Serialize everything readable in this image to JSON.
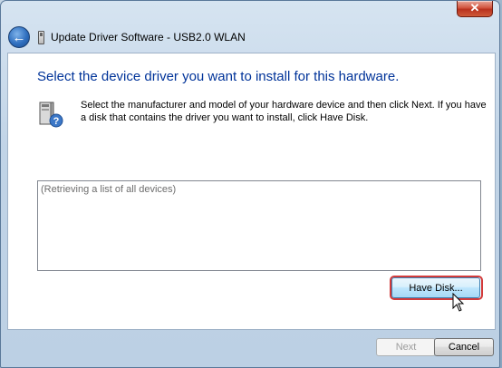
{
  "window": {
    "title": "Update Driver Software - USB2.0 WLAN",
    "close_label": "✕"
  },
  "icons": {
    "back": "back-arrow-icon",
    "device": "usb-device-icon",
    "hardware": "hardware-install-icon"
  },
  "main": {
    "heading": "Select the device driver you want to install for this hardware.",
    "instructions": "Select the manufacturer and model of your hardware device and then click Next. If you have a disk that contains the driver you want to install, click Have Disk.",
    "device_list_status": "(Retrieving a list of all devices)",
    "have_disk_label": "Have Disk..."
  },
  "footer": {
    "next_label": "Next",
    "cancel_label": "Cancel"
  },
  "colors": {
    "heading": "#003399",
    "highlight_ring": "#d23b3b",
    "close_button": "#c7432b"
  }
}
